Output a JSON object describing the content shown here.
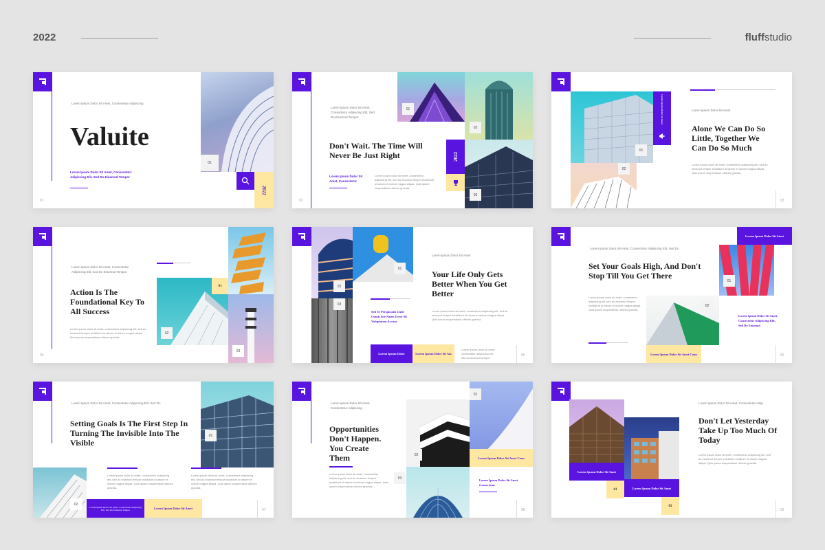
{
  "header": {
    "year": "2022",
    "brand_bold": "fluff",
    "brand_rest": "studio"
  },
  "common": {
    "lorem_para": "Lorem ipsum dolor sit amet, consectetur adipiscing elit, sed do eiusmod tempor incididunt ut labore et dolore magna aliqua. Quis ipsum suspendisse ultrices gravida.",
    "lorem_short": "Lorem Ipsum Dolor Sit Amet, Consectetur Adipiscing Elit, Sed Do Eiusmod Tempor"
  },
  "slides": [
    {
      "kicker": "Lorem Ipsum Dolor Sit Amet, Consectetur Adipiscing",
      "title": "Valuite",
      "sub": "Lorem Ipsum Dolor Sit Amet, Consectetur Adipiscing Elit, Sed Do Eiusmod Tempor",
      "tag1": "01",
      "year": "2022",
      "page": "01"
    },
    {
      "kicker": "Lorem Ipsum Dolor Sit Amet, Consectetur Adipiscing Elit, Sed Do Eiusmod Tempor",
      "title": "Don't Wait. The Time Will Never Be Just Right",
      "sub": "Lorem Ipsum Dolor Sit Amet, Consectetur",
      "tag1": "01",
      "tag2": "02",
      "tag3": "03",
      "year": "2022",
      "page": "02"
    },
    {
      "kicker": "Lorem Ipsum Dolor Sit Amet",
      "title": "Alone We Can Do So Little, Together We Can Do So Much",
      "vert": "Lorem Ipsum Dolor Sit Amet",
      "tag1": "01",
      "tag2": "02",
      "page": "03"
    },
    {
      "kicker": "Lorem Ipsum Dolor Sit Amet, Consectetur Adipiscing Elit, Sed Do Eiusmod Tempor",
      "title": "Action Is The Foundational Key To All Success",
      "tag1": "01",
      "tag2": "02",
      "tag3": "03",
      "page": "04"
    },
    {
      "kicker": "Lorem Ipsum Dolor Sit Amet",
      "title": "Your Life Only Gets Better When You Get Better",
      "sub": "Sed Ut Perspiciatis Unde Omnis Iste Natus Error Sit Voluptatem Accusa",
      "btn1": "Lorem Ipsum Dolor",
      "btn2": "Lorem Ipsum Dolor Sit Am",
      "tag1": "01",
      "tag2": "02",
      "tag3": "03",
      "page": "05"
    },
    {
      "kicker": "Lorem Ipsum Dolor Sit Amet, Consectetur Adipiscing Elit, Sed Do",
      "title": "Set Your Goals High, And Don't Stop Till You Get There",
      "topbox": "Lorem Ipsum Dolor Sit Amet",
      "sub": "Lorem Ipsum Dolor Sit Amet, Consectetur Adipiscing Elit, Sed Do Eiusmod",
      "btn": "Lorem Ipsum Dolor Sit Amet Conn",
      "tag1": "01",
      "tag2": "02",
      "page": "06"
    },
    {
      "kicker": "Lorem Ipsum Dolor Sit Amet, Consectetur Adipiscing Elit, Sed Do",
      "title": "Setting Goals Is The First Step In Turning The Invisible Into The Visible",
      "btn": "Lorem Ipsum Dolor Sit Amet",
      "tag1": "01",
      "tag2": "02",
      "page": "07"
    },
    {
      "kicker": "Lorem Ipsum Dolor Sit Amet, Consectetur Adipiscing",
      "title": "Opportunities Don't Happen. You Create Them",
      "ybox": "Lorem Ipsum Dolor Sit Amet Conn",
      "sub": "Lorem Ipsum Dolor Sit Amet, Consectetur",
      "tag1": "01",
      "tag2": "02",
      "tag3": "03",
      "page": "08"
    },
    {
      "kicker": "Lorem Ipsum Dolor Sit Amet, Consectetur Adipi",
      "title": "Don't Let Yesterday Take Up Too Much Of Today",
      "box1": "Lorem Ipsum Dolor Sit Amet",
      "box2": "Lorem Ipsum Dolor Sit Amet",
      "tag1": "01",
      "tag2": "02",
      "page": "09"
    }
  ]
}
